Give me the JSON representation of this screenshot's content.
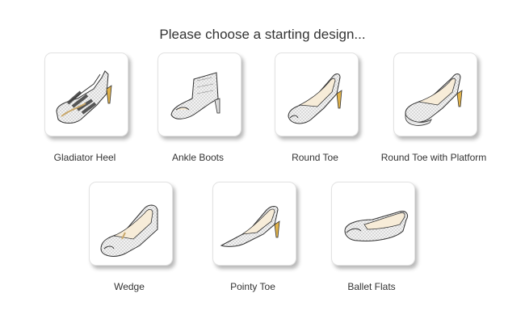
{
  "page": {
    "title": "Please choose a starting design..."
  },
  "designs": [
    {
      "label": "Gladiator Heel",
      "icon": "gladiator-heel-shoe-icon"
    },
    {
      "label": "Ankle Boots",
      "icon": "ankle-boot-icon"
    },
    {
      "label": "Round Toe",
      "icon": "round-toe-shoe-icon"
    },
    {
      "label": "Round Toe with Platform",
      "icon": "round-toe-platform-shoe-icon"
    },
    {
      "label": "Wedge",
      "icon": "wedge-shoe-icon"
    },
    {
      "label": "Pointy Toe",
      "icon": "pointy-toe-shoe-icon"
    },
    {
      "label": "Ballet Flats",
      "icon": "ballet-flat-icon"
    }
  ],
  "colors": {
    "shoe_fill": "#f1f1f1",
    "shoe_dots": "#9a9a9a",
    "insole": "#f7ecd8",
    "heel_accent": "#e0b24a",
    "outline": "#333333"
  }
}
